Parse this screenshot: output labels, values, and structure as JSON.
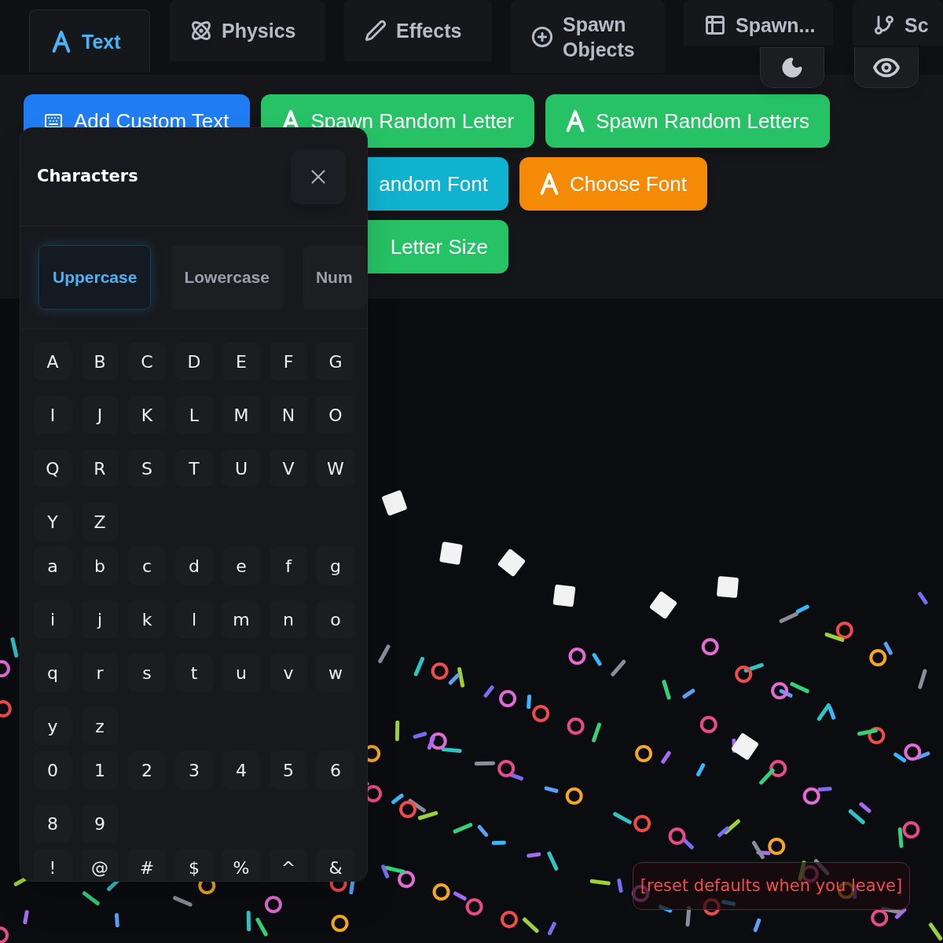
{
  "tabs": [
    {
      "label": "Text",
      "selected": true
    },
    {
      "label": "Physics",
      "selected": false
    },
    {
      "label": "Effects",
      "selected": false
    },
    {
      "label": "Spawn Objects",
      "selected": false
    },
    {
      "label": "Spawn...",
      "selected": false
    },
    {
      "label": "Sc",
      "selected": false
    }
  ],
  "toolbar": {
    "buttons": [
      {
        "label": "Add Custom Text",
        "color": "#1f7cf2"
      },
      {
        "label": "Spawn Random Letter",
        "color": "#27c265"
      },
      {
        "label": "Spawn Random Letters",
        "color": "#27c265"
      },
      {
        "label": "andom Font",
        "color": "#0fb3cf"
      },
      {
        "label": "Choose Font",
        "color": "#f58a07"
      },
      {
        "label": "Letter Size",
        "color": "#27c265"
      }
    ]
  },
  "panel": {
    "title": "Characters",
    "categories": [
      {
        "label": "Uppercase",
        "selected": true
      },
      {
        "label": "Lowercase",
        "selected": false
      },
      {
        "label": "Num",
        "selected": false
      }
    ],
    "groups": [
      [
        "A",
        "B",
        "C",
        "D",
        "E",
        "F",
        "G",
        "I",
        "J",
        "K",
        "L",
        "M",
        "N",
        "O",
        "Q",
        "R",
        "S",
        "T",
        "U",
        "V",
        "W",
        "Y",
        "Z"
      ],
      [
        "a",
        "b",
        "c",
        "d",
        "e",
        "f",
        "g",
        "i",
        "j",
        "k",
        "l",
        "m",
        "n",
        "o",
        "q",
        "r",
        "s",
        "t",
        "u",
        "v",
        "w",
        "y",
        "z"
      ],
      [
        "0",
        "1",
        "2",
        "3",
        "4",
        "5",
        "6",
        "8",
        "9"
      ],
      [
        "!",
        "@",
        "#",
        "$",
        "%",
        "^",
        "&"
      ]
    ]
  },
  "notice": "[reset defaults when you leave]"
}
